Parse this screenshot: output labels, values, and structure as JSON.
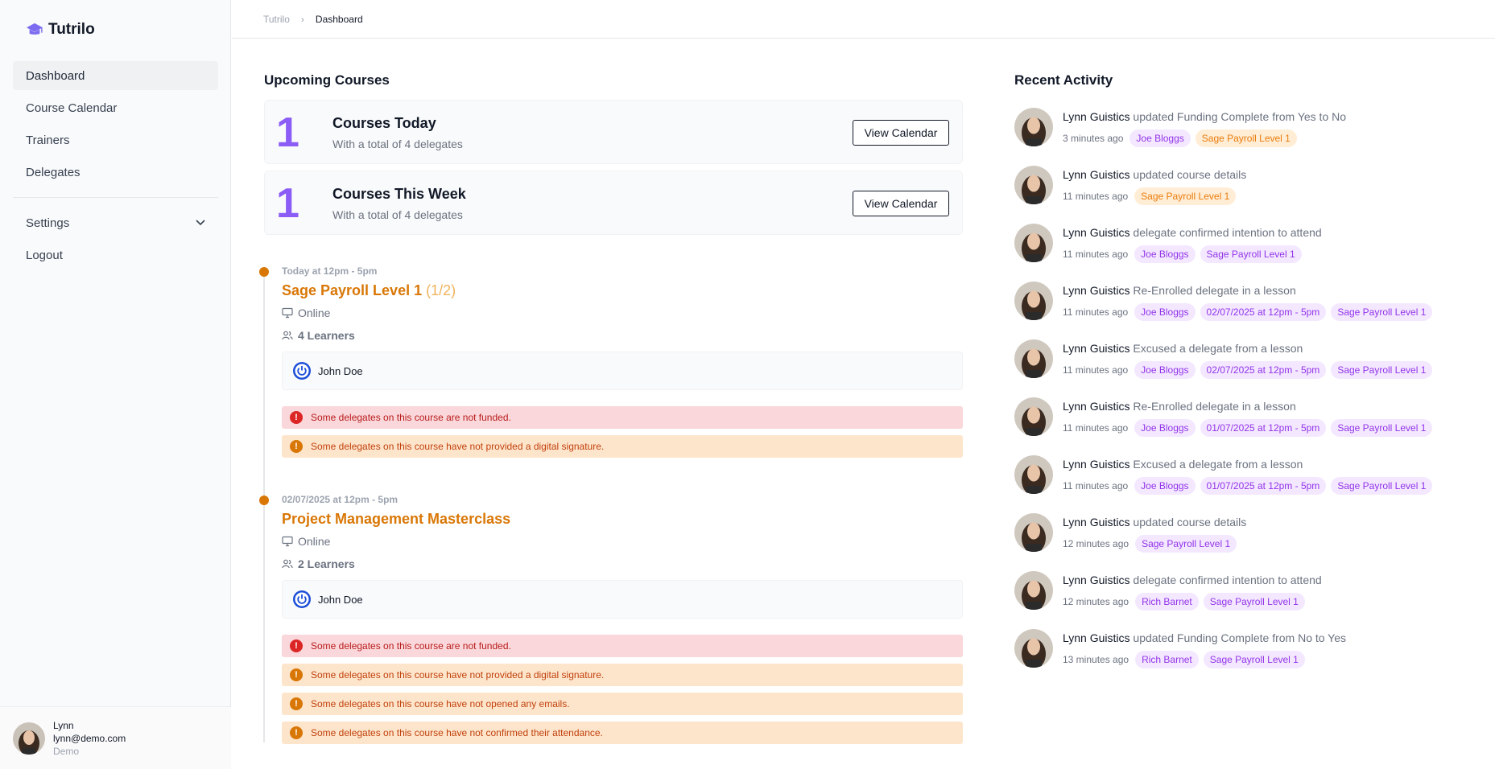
{
  "app": {
    "name": "Tutrilo",
    "accent": "#8b5cf6",
    "brand_icon": "graduation-cap-icon"
  },
  "breadcrumb": {
    "root": "Tutrilo",
    "separator": "›",
    "current": "Dashboard"
  },
  "sidebar": {
    "items": [
      {
        "label": "Dashboard",
        "active": true
      },
      {
        "label": "Course Calendar"
      },
      {
        "label": "Trainers"
      },
      {
        "label": "Delegates"
      }
    ],
    "settings_label": "Settings",
    "logout_label": "Logout",
    "user": {
      "name": "Lynn",
      "email": "lynn@demo.com",
      "role": "Demo"
    }
  },
  "upcoming": {
    "title": "Upcoming Courses",
    "today": {
      "count": "1",
      "title": "Courses Today",
      "subtitle": "With a total of 4 delegates",
      "button": "View Calendar"
    },
    "week": {
      "count": "1",
      "title": "Courses This Week",
      "subtitle": "With a total of 4 delegates",
      "button": "View Calendar"
    },
    "courses": [
      {
        "time": "Today at 12pm - 5pm",
        "title": "Sage Payroll Level 1",
        "fraction": "(1/2)",
        "location": "Online",
        "learners": "4 Learners",
        "trainer": "John Doe",
        "alerts": [
          {
            "type": "error",
            "text": "Some delegates on this course are not funded."
          },
          {
            "type": "warn",
            "text": "Some delegates on this course have not provided a digital signature."
          }
        ]
      },
      {
        "time": "02/07/2025 at 12pm - 5pm",
        "title": "Project Management Masterclass",
        "fraction": "",
        "location": "Online",
        "learners": "2 Learners",
        "trainer": "John Doe",
        "alerts": [
          {
            "type": "error",
            "text": "Some delegates on this course are not funded."
          },
          {
            "type": "warn",
            "text": "Some delegates on this course have not provided a digital signature."
          },
          {
            "type": "warn",
            "text": "Some delegates on this course have not opened any emails."
          },
          {
            "type": "warn",
            "text": "Some delegates on this course have not confirmed their attendance."
          }
        ]
      }
    ]
  },
  "activity": {
    "title": "Recent Activity",
    "items": [
      {
        "user": "Lynn Guistics",
        "action": "updated Funding Complete from Yes to No",
        "time": "3 minutes ago",
        "tags": [
          {
            "text": "Joe Bloggs",
            "color": "purple"
          },
          {
            "text": "Sage Payroll Level 1",
            "color": "orange"
          }
        ]
      },
      {
        "user": "Lynn Guistics",
        "action": "updated course details",
        "time": "11 minutes ago",
        "tags": [
          {
            "text": "Sage Payroll Level 1",
            "color": "orange"
          }
        ]
      },
      {
        "user": "Lynn Guistics",
        "action": "delegate confirmed intention to attend",
        "time": "11 minutes ago",
        "tags": [
          {
            "text": "Joe Bloggs",
            "color": "purple"
          },
          {
            "text": "Sage Payroll Level 1",
            "color": "purple"
          }
        ]
      },
      {
        "user": "Lynn Guistics",
        "action": "Re-Enrolled delegate in a lesson",
        "time": "11 minutes ago",
        "tags": [
          {
            "text": "Joe Bloggs",
            "color": "purple"
          },
          {
            "text": "02/07/2025 at 12pm - 5pm",
            "color": "purple"
          },
          {
            "text": "Sage Payroll Level 1",
            "color": "purple"
          }
        ]
      },
      {
        "user": "Lynn Guistics",
        "action": "Excused a delegate from a lesson",
        "time": "11 minutes ago",
        "tags": [
          {
            "text": "Joe Bloggs",
            "color": "purple"
          },
          {
            "text": "02/07/2025 at 12pm - 5pm",
            "color": "purple"
          },
          {
            "text": "Sage Payroll Level 1",
            "color": "purple"
          }
        ]
      },
      {
        "user": "Lynn Guistics",
        "action": "Re-Enrolled delegate in a lesson",
        "time": "11 minutes ago",
        "tags": [
          {
            "text": "Joe Bloggs",
            "color": "purple"
          },
          {
            "text": "01/07/2025 at 12pm - 5pm",
            "color": "purple"
          },
          {
            "text": "Sage Payroll Level 1",
            "color": "purple"
          }
        ]
      },
      {
        "user": "Lynn Guistics",
        "action": "Excused a delegate from a lesson",
        "time": "11 minutes ago",
        "tags": [
          {
            "text": "Joe Bloggs",
            "color": "purple"
          },
          {
            "text": "01/07/2025 at 12pm - 5pm",
            "color": "purple"
          },
          {
            "text": "Sage Payroll Level 1",
            "color": "purple"
          }
        ]
      },
      {
        "user": "Lynn Guistics",
        "action": "updated course details",
        "time": "12 minutes ago",
        "tags": [
          {
            "text": "Sage Payroll Level 1",
            "color": "purple"
          }
        ]
      },
      {
        "user": "Lynn Guistics",
        "action": "delegate confirmed intention to attend",
        "time": "12 minutes ago",
        "tags": [
          {
            "text": "Rich Barnet",
            "color": "purple"
          },
          {
            "text": "Sage Payroll Level 1",
            "color": "purple"
          }
        ]
      },
      {
        "user": "Lynn Guistics",
        "action": "updated Funding Complete from No to Yes",
        "time": "13 minutes ago",
        "tags": [
          {
            "text": "Rich Barnet",
            "color": "purple"
          },
          {
            "text": "Sage Payroll Level 1",
            "color": "purple"
          }
        ]
      }
    ]
  }
}
